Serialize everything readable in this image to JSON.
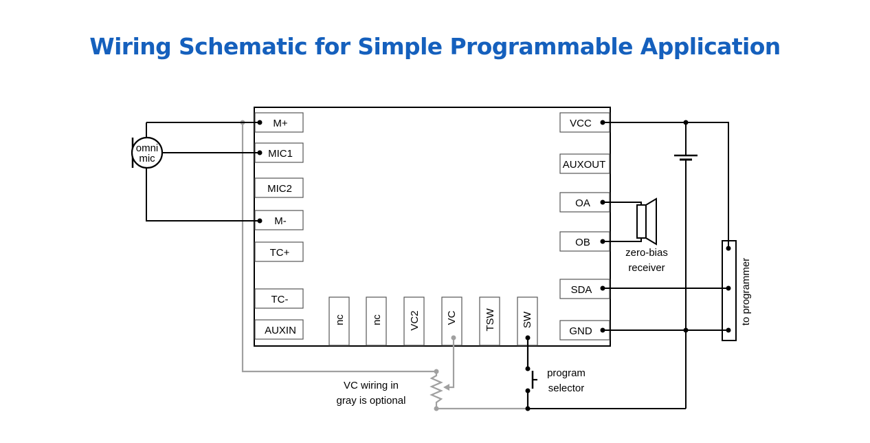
{
  "title": "Wiring Schematic for Simple Programmable Application",
  "colors": {
    "title": "#1560bd",
    "wire": "#000000",
    "optional_wire": "#a0a0a0",
    "background": "#ffffff"
  },
  "chip": {
    "left_pins": [
      "M+",
      "MIC1",
      "MIC2",
      "M-",
      "TC+",
      "TC-",
      "AUXIN"
    ],
    "right_pins": [
      "VCC",
      "AUXOUT",
      "OA",
      "OB",
      "SDA",
      "GND"
    ],
    "bottom_pins": [
      "nc",
      "nc",
      "VC2",
      "VC",
      "TSW",
      "SW"
    ]
  },
  "components": {
    "microphone": {
      "line1": "omni",
      "line2": "mic"
    },
    "receiver": {
      "line1": "zero-bias",
      "line2": "receiver"
    },
    "switch": {
      "line1": "program",
      "line2": "selector"
    },
    "programmer": {
      "label": "to programmer"
    },
    "optional_note": {
      "line1": "VC wiring in",
      "line2": "gray is optional"
    }
  }
}
